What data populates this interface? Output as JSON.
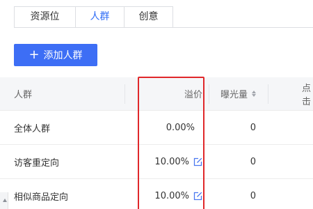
{
  "tabs": [
    {
      "label": "资源位",
      "active": false
    },
    {
      "label": "人群",
      "active": true
    },
    {
      "label": "创意",
      "active": false
    }
  ],
  "add_button": {
    "label": "添加人群",
    "icon": "plus-icon"
  },
  "table": {
    "headers": {
      "name": "人群",
      "premium": "溢价",
      "exposure": "曝光量",
      "clicks": "点击"
    },
    "rows": [
      {
        "name": "全体人群",
        "premium": "0.00%",
        "editable": false,
        "exposure": "0"
      },
      {
        "name": "访客重定向",
        "premium": "10.00%",
        "editable": true,
        "exposure": "0"
      },
      {
        "name": "相似商品定向",
        "premium": "10.00%",
        "editable": true,
        "exposure": "0"
      }
    ]
  },
  "colors": {
    "accent": "#3d6ef5",
    "active_tab": "#2e6cf6",
    "highlight": "#e0272a"
  }
}
